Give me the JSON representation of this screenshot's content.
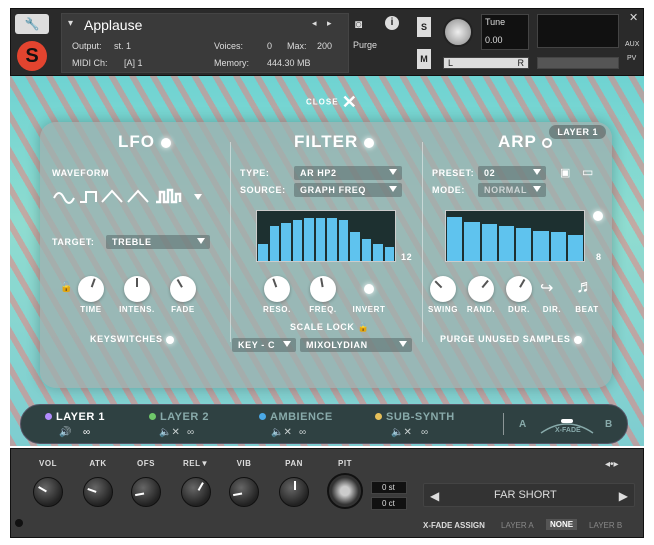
{
  "header": {
    "instrument": "Applause",
    "output_label": "Output:",
    "output_value": "st. 1",
    "voices_label": "Voices:",
    "voices_value": "0",
    "max_label": "Max:",
    "max_value": "200",
    "purge_label": "Purge",
    "midi_label": "MIDI Ch:",
    "midi_value": "[A] 1",
    "memory_label": "Memory:",
    "memory_value": "444.30 MB",
    "tune_label": "Tune",
    "tune_value": "0.00",
    "s_label": "S",
    "m_label": "M",
    "aux_label": "AUX",
    "pv_label": "PV",
    "lr_left": "L",
    "lr_right": "R"
  },
  "close_label": "CLOSE",
  "layer_badge": "LAYER 1",
  "lfo": {
    "title": "LFO",
    "waveform_label": "WAVEFORM",
    "target_label": "TARGET:",
    "target_value": "TREBLE",
    "knobs": [
      "TIME",
      "INTENS.",
      "FADE"
    ],
    "keyswitches_label": "KEYSWITCHES"
  },
  "filter": {
    "title": "FILTER",
    "type_label": "TYPE:",
    "type_value": "AR HP2",
    "source_label": "SOURCE:",
    "source_value": "GRAPH FREQ",
    "steps_value": "12",
    "bars": [
      0.35,
      0.72,
      0.8,
      0.85,
      0.9,
      0.9,
      0.9,
      0.85,
      0.6,
      0.45,
      0.35,
      0.3
    ],
    "knobs": [
      "RESO.",
      "FREQ.",
      "INVERT"
    ],
    "scale_lock_label": "SCALE LOCK",
    "key_value": "KEY - C",
    "mode_value": "MIXOLYDIAN"
  },
  "arp": {
    "title": "ARP",
    "preset_label": "PRESET:",
    "preset_value": "02",
    "mode_label": "MODE:",
    "mode_value": "NORMAL",
    "steps_value": "8",
    "bars": [
      0.92,
      0.82,
      0.78,
      0.72,
      0.68,
      0.62,
      0.6,
      0.55
    ],
    "knobs": [
      "SWING",
      "RAND.",
      "DUR.",
      "DIR.",
      "BEAT"
    ],
    "purge_label": "PURGE UNUSED SAMPLES"
  },
  "layers": [
    {
      "label": "LAYER 1",
      "color": "#b38cff"
    },
    {
      "label": "LAYER 2",
      "color": "#6fc86a"
    },
    {
      "label": "AMBIENCE",
      "color": "#4aa8e6"
    },
    {
      "label": "SUB-SYNTH",
      "color": "#e6c05a"
    }
  ],
  "xfade": {
    "a": "A",
    "b": "B",
    "label": "X-FADE"
  },
  "bottom": {
    "knobs": [
      "VOL",
      "ATK",
      "OFS",
      "REL▼",
      "VIB",
      "PAN",
      "PIT"
    ],
    "pit_st": "0 st",
    "pit_ct": "0 ct",
    "preset_name": "FAR SHORT",
    "xfade_assign_label": "X-FADE ASSIGN",
    "assign_options": [
      "LAYER A",
      "NONE",
      "LAYER B"
    ]
  },
  "colors": {
    "accent": "#5fc3ee",
    "panel": "#9eb0ae"
  }
}
